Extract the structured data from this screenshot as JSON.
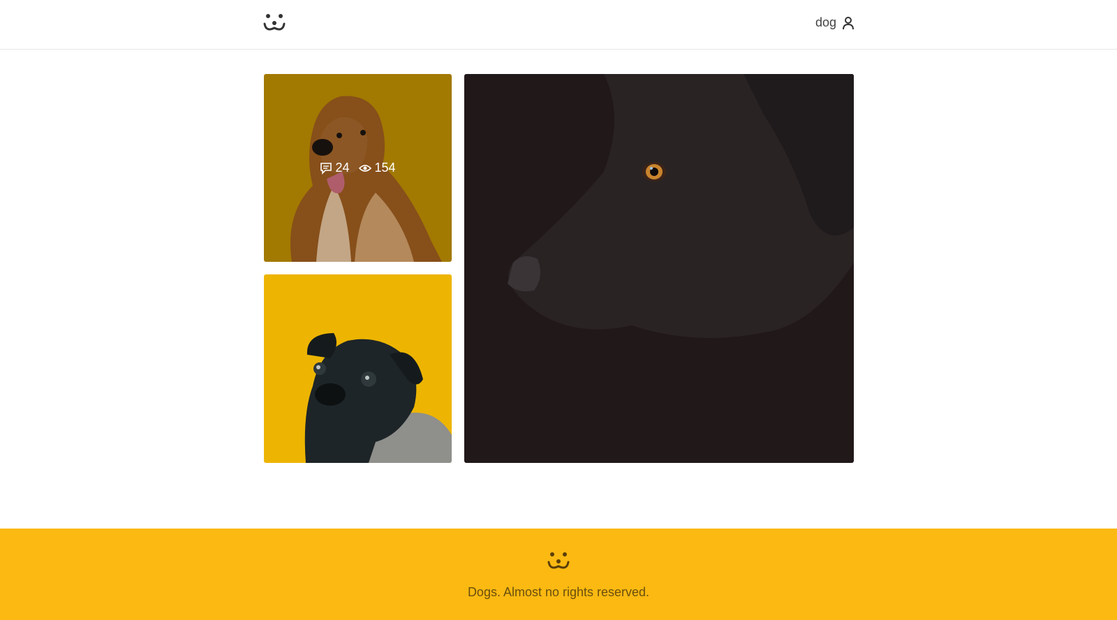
{
  "header": {
    "logo_icon": "dog-face-icon",
    "user_label": "dog",
    "user_icon": "user-icon"
  },
  "feed": {
    "photos": [
      {
        "subject": "Afghan hound on yellow background",
        "comments": "24",
        "views": "154",
        "hover_stats_visible": true
      },
      {
        "subject": "Black pug in grey sweater on yellow background"
      },
      {
        "subject": "Black labrador profile on dark background"
      }
    ],
    "comment_icon": "comment-icon",
    "views_icon": "eye-icon"
  },
  "footer": {
    "logo_icon": "dog-face-icon",
    "text": "Dogs. Almost no rights reserved."
  },
  "colors": {
    "accent": "#fbb912",
    "footer_text": "#6b4f0e",
    "header_border": "#e6e6e6"
  }
}
